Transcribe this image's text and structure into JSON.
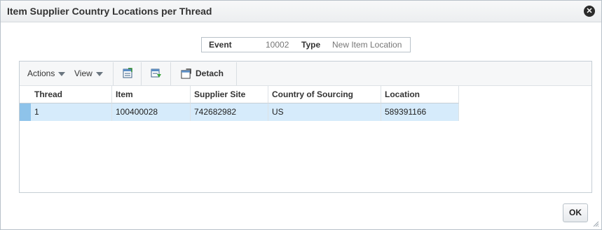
{
  "dialog": {
    "title": "Item Supplier Country Locations per Thread",
    "close_icon": "close-icon"
  },
  "info": {
    "event_label": "Event",
    "event_value": "10002",
    "type_label": "Type",
    "type_value": "New Item Location"
  },
  "toolbar": {
    "actions_label": "Actions",
    "view_label": "View",
    "icons": [
      "export-icon",
      "freeze-columns-icon",
      "detach-icon"
    ],
    "detach_label": "Detach"
  },
  "table": {
    "columns": [
      "Thread",
      "Item",
      "Supplier Site",
      "Country of Sourcing",
      "Location"
    ],
    "rows": [
      [
        "1",
        "100400028",
        "742682982",
        "US",
        "589391166"
      ]
    ]
  },
  "footer": {
    "ok_label": "OK"
  },
  "colors": {
    "selected_row": "#d6ebfb",
    "row_selector": "#8ec3ea"
  }
}
